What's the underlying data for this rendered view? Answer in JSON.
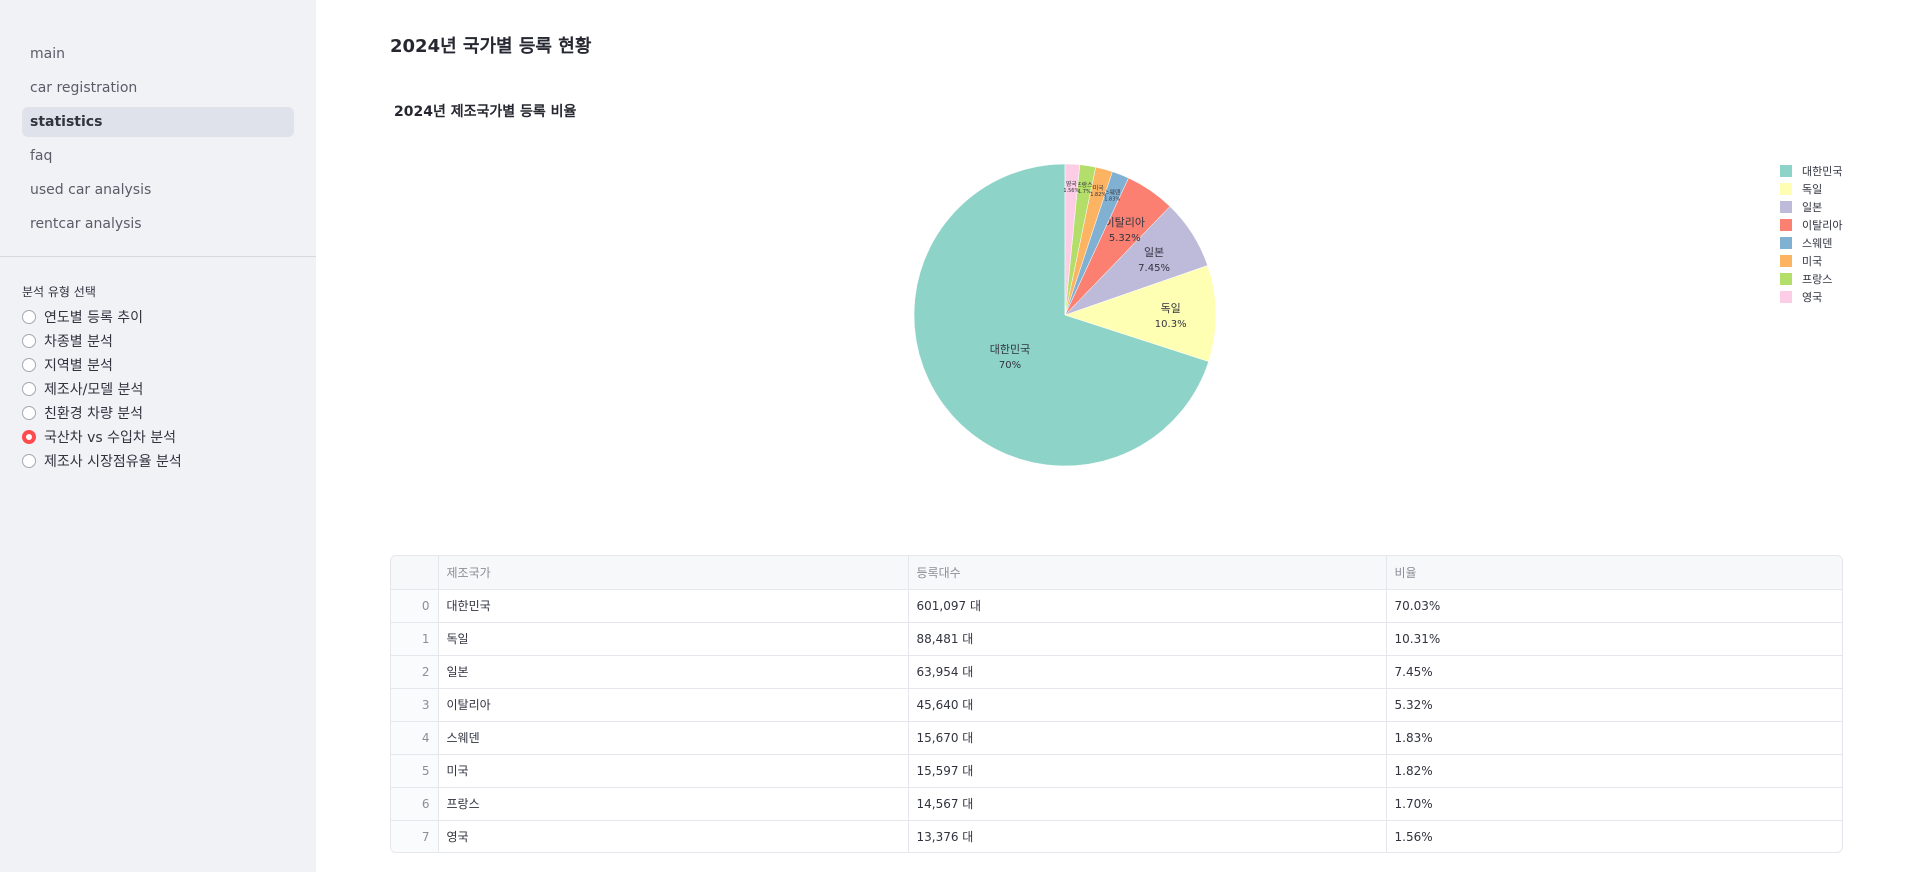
{
  "sidebar": {
    "nav": [
      {
        "label": "main"
      },
      {
        "label": "car registration"
      },
      {
        "label": "statistics",
        "active": true
      },
      {
        "label": "faq"
      },
      {
        "label": "used car analysis"
      },
      {
        "label": "rentcar analysis"
      }
    ],
    "radio_title": "분석 유형 선택",
    "radio_options": [
      {
        "label": "연도별 등록 추이",
        "checked": false
      },
      {
        "label": "차종별 분석",
        "checked": false
      },
      {
        "label": "지역별 분석",
        "checked": false
      },
      {
        "label": "제조사/모델 분석",
        "checked": false
      },
      {
        "label": "친환경 차량 분석",
        "checked": false
      },
      {
        "label": "국산차 vs 수입차 분석",
        "checked": true
      },
      {
        "label": "제조사 시장점유율 분석",
        "checked": false
      }
    ]
  },
  "main": {
    "page_title": "2024년 국가별 등록 현황",
    "chart_title": "2024년 제조국가별 등록 비율"
  },
  "chart_data": {
    "type": "pie",
    "title": "2024년 제조국가별 등록 비율",
    "labels": [
      "대한민국",
      "독일",
      "일본",
      "이탈리아",
      "스웨덴",
      "미국",
      "프랑스",
      "영국"
    ],
    "values": [
      70.03,
      10.31,
      7.45,
      5.32,
      1.83,
      1.82,
      1.7,
      1.56
    ],
    "slice_text": [
      "70%",
      "10.3%",
      "7.45%",
      "5.32%",
      "1.83%",
      "1.82%",
      "1.7%",
      "1.56%"
    ],
    "colors": [
      "#8dd3c7",
      "#ffffb3",
      "#bebada",
      "#fb8072",
      "#80b1d3",
      "#fdb462",
      "#b3de69",
      "#fccde5"
    ],
    "legend_position": "top-right"
  },
  "table": {
    "columns": [
      "",
      "제조국가",
      "등록대수",
      "비율"
    ],
    "rows": [
      [
        "0",
        "대한민국",
        "601,097 대",
        "70.03%"
      ],
      [
        "1",
        "독일",
        "88,481 대",
        "10.31%"
      ],
      [
        "2",
        "일본",
        "63,954 대",
        "7.45%"
      ],
      [
        "3",
        "이탈리아",
        "45,640 대",
        "5.32%"
      ],
      [
        "4",
        "스웨덴",
        "15,670 대",
        "1.83%"
      ],
      [
        "5",
        "미국",
        "15,597 대",
        "1.82%"
      ],
      [
        "6",
        "프랑스",
        "14,567 대",
        "1.70%"
      ],
      [
        "7",
        "영국",
        "13,376 대",
        "1.56%"
      ]
    ]
  },
  "icons": {
    "radio_checked_color": "#ff4b4b"
  }
}
